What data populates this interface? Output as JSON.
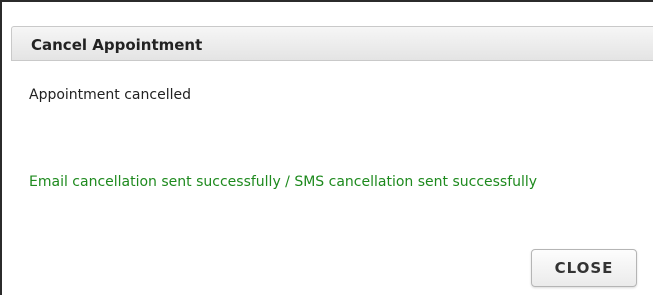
{
  "dialog": {
    "title": "Cancel Appointment",
    "message": "Appointment cancelled",
    "notification": "Email cancellation sent successfully / SMS cancellation sent successfully",
    "notification_color": "#1e8a1e",
    "close_label": "CLOSE"
  }
}
